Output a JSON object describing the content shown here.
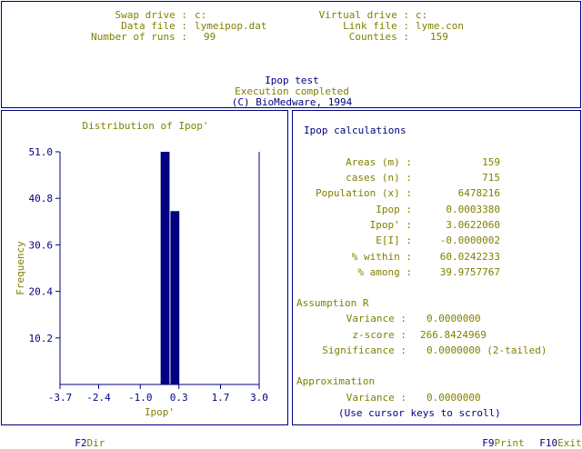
{
  "header": {
    "swap_drive_label": "Swap drive :",
    "swap_drive_value": "c:",
    "virtual_drive_label": "Virtual drive :",
    "virtual_drive_value": "c:",
    "data_file_label": "Data file :",
    "data_file_value": "lymeipop.dat",
    "link_file_label": "Link file :",
    "link_file_value": "lyme.con",
    "runs_label": "Number of runs :",
    "runs_value": "99",
    "counties_label": "Counties :",
    "counties_value": "159",
    "title": "Ipop test",
    "status": "Execution completed",
    "copyright": "(C) BioMedware, 1994"
  },
  "chart_data": {
    "type": "bar",
    "title": "Distribution of Ipop'",
    "xlabel": "Ipop'",
    "ylabel": "Frequency",
    "xlim": [
      -3.7,
      3.0
    ],
    "ylim": [
      0,
      51.0
    ],
    "xticks": [
      "-3.7",
      "-2.4",
      "-1.0",
      "0.3",
      "1.7",
      "3.0"
    ],
    "yticks": [
      "51.0",
      "40.8",
      "30.6",
      "20.4",
      "10.2"
    ],
    "bins": [
      {
        "x0": -0.33,
        "x1": 0.0,
        "value": 51
      },
      {
        "x0": 0.0,
        "x1": 0.33,
        "value": 38
      }
    ],
    "observed_value": 3.0
  },
  "results": {
    "heading": "Ipop calculations",
    "rows": [
      {
        "label": "Areas (m) :",
        "value": "159"
      },
      {
        "label": "cases (n) :",
        "value": "715"
      },
      {
        "label": "Population (x) :",
        "value": "6478216"
      },
      {
        "label": "Ipop :",
        "value": "0.0003380"
      },
      {
        "label": "Ipop' :",
        "value": "3.0622060"
      },
      {
        "label": "E[I] :",
        "value": "-0.0000002"
      },
      {
        "label": "% within :",
        "value": "60.0242233"
      },
      {
        "label": "% among :",
        "value": "39.9757767"
      }
    ],
    "assumption_heading": "Assumption R",
    "assumption_rows": [
      {
        "label": "Variance :",
        "value": "0.0000000"
      },
      {
        "label": "z-score :",
        "value": "266.8424969"
      },
      {
        "label": "Significance :",
        "value": "0.0000000 (2-tailed)"
      }
    ],
    "approx_heading": "Approximation",
    "approx_rows": [
      {
        "label": "Variance :",
        "value": "0.0000000"
      }
    ],
    "scroll_hint": "(Use cursor keys to scroll)"
  },
  "footer": {
    "f2_key": "F2",
    "f2_label": "Dir",
    "f9_key": "F9",
    "f9_label": "Print",
    "f10_key": "F10",
    "f10_label": "Exit"
  },
  "colors": {
    "text": "#808000",
    "accent": "#000080",
    "background": "#ffffff"
  }
}
